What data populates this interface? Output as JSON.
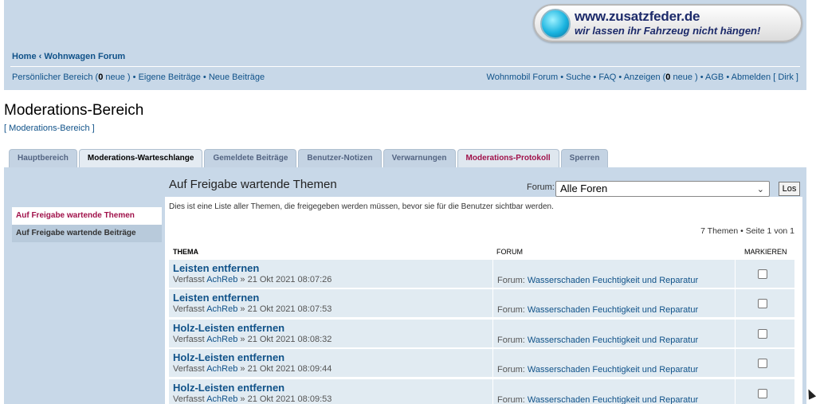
{
  "banner": {
    "url": "www.zusatzfeder.de",
    "slogan": "wir lassen ihr Fahrzeug nicht hängen!"
  },
  "breadcrumb": {
    "home": "Home",
    "sep": "‹",
    "forum": "Wohnwagen Forum"
  },
  "nav_left": {
    "personal_prefix": "Persönlicher Bereich (",
    "personal_count": "0",
    "personal_suffix": " neue )",
    "dot1": " • ",
    "own_posts": "Eigene Beiträge",
    "dot2": " • ",
    "new_posts": "Neue Beiträge"
  },
  "nav_right": {
    "wohnmobil": "Wohnmobil Forum",
    "dot1": " • ",
    "search": "Suche",
    "dot2": " • ",
    "faq": "FAQ",
    "dot3": " • ",
    "ads_prefix": "Anzeigen (",
    "ads_count": "0",
    "ads_suffix": " neue )",
    "dot4": " • ",
    "agb": "AGB",
    "dot5": " • ",
    "logout": "Abmelden [ Dirk ]"
  },
  "page": {
    "title": "Moderations-Bereich",
    "subcrumb": "[ Moderations-Bereich ]"
  },
  "tabs": [
    "Hauptbereich",
    "Moderations-Warteschlange",
    "Gemeldete Beiträge",
    "Benutzer-Notizen",
    "Verwarnungen",
    "Moderations-Protokoll",
    "Sperren"
  ],
  "sidebar": {
    "items": [
      "Auf Freigabe wartende Themen",
      "Auf Freigabe wartende Beiträge"
    ]
  },
  "main": {
    "title": "Auf Freigabe wartende Themen",
    "forum_label": "Forum:",
    "forum_selected": "Alle Foren",
    "go_button": "Los",
    "description": "Dies ist eine Liste aller Themen, die freigegeben werden müssen, bevor sie für die Benutzer sichtbar werden.",
    "pagination": "7 Themen • Seite 1 von 1",
    "columns": {
      "thema": "THEMA",
      "forum": "FORUM",
      "mark": "MARKIEREN"
    },
    "rows": [
      {
        "title": "Leisten entfernen",
        "by": "Verfasst ",
        "author": "AchReb",
        "date": " » 21 Okt 2021 08:07:26",
        "forum_label": "Forum: ",
        "forum": "Wasserschaden Feuchtigkeit und Reparatur"
      },
      {
        "title": "Leisten entfernen",
        "by": "Verfasst ",
        "author": "AchReb",
        "date": " » 21 Okt 2021 08:07:53",
        "forum_label": "Forum: ",
        "forum": "Wasserschaden Feuchtigkeit und Reparatur"
      },
      {
        "title": "Holz-Leisten entfernen",
        "by": "Verfasst ",
        "author": "AchReb",
        "date": " » 21 Okt 2021 08:08:32",
        "forum_label": "Forum: ",
        "forum": "Wasserschaden Feuchtigkeit und Reparatur"
      },
      {
        "title": "Holz-Leisten entfernen",
        "by": "Verfasst ",
        "author": "AchReb",
        "date": " » 21 Okt 2021 08:09:44",
        "forum_label": "Forum: ",
        "forum": "Wasserschaden Feuchtigkeit und Reparatur"
      },
      {
        "title": "Holz-Leisten entfernen",
        "by": "Verfasst ",
        "author": "AchReb",
        "date": " » 21 Okt 2021 08:09:53",
        "forum_label": "Forum: ",
        "forum": "Wasserschaden Feuchtigkeit und Reparatur"
      }
    ]
  }
}
